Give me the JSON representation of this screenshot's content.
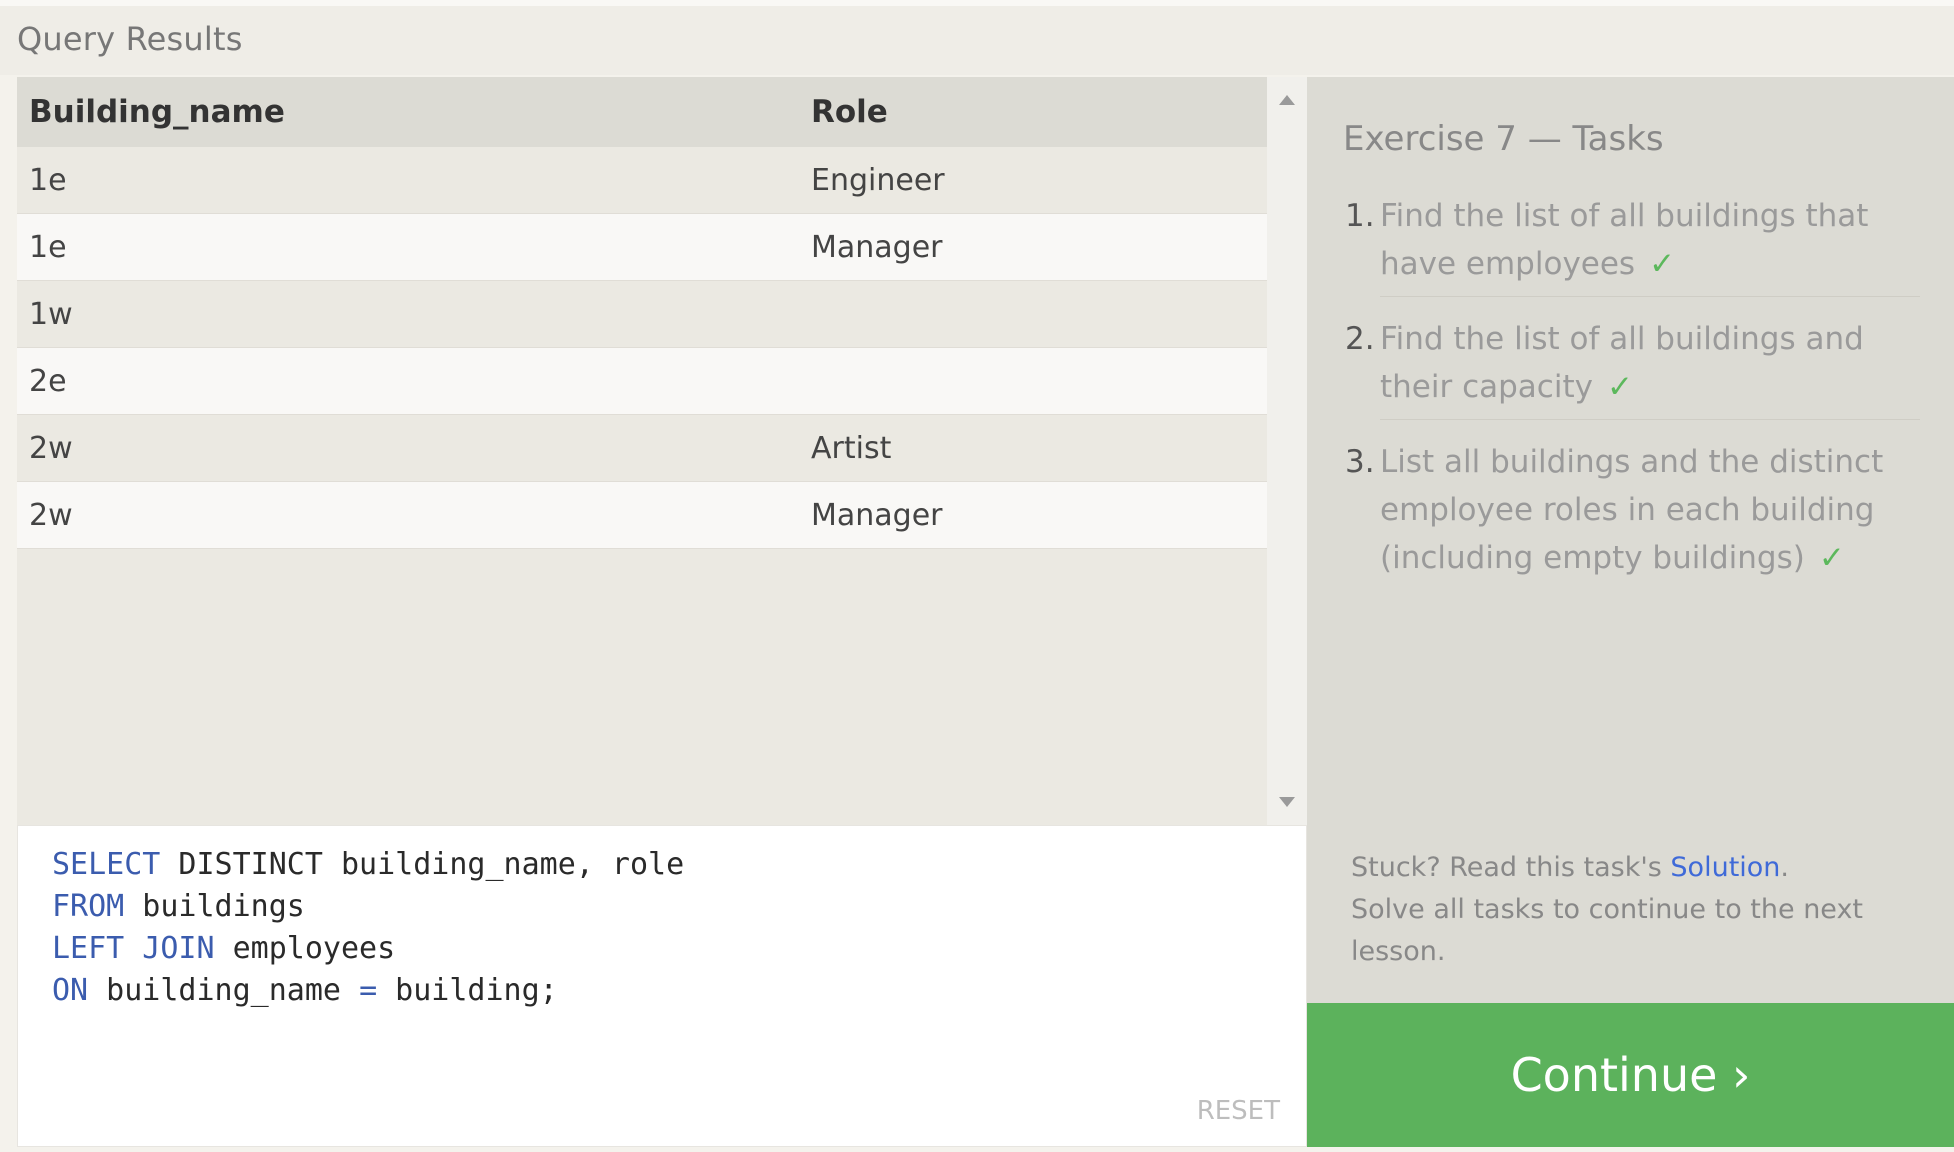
{
  "header": {
    "title": "Query Results"
  },
  "table": {
    "columns": [
      "Building_name",
      "Role"
    ],
    "rows": [
      [
        "1e",
        "Engineer"
      ],
      [
        "1e",
        "Manager"
      ],
      [
        "1w",
        ""
      ],
      [
        "2e",
        ""
      ],
      [
        "2w",
        "Artist"
      ],
      [
        "2w",
        "Manager"
      ]
    ]
  },
  "editor": {
    "lines": [
      [
        [
          "kw",
          "SELECT"
        ],
        [
          "id",
          " DISTINCT building_name, role"
        ]
      ],
      [
        [
          "kw",
          "FROM"
        ],
        [
          "id",
          " buildings"
        ]
      ],
      [
        [
          "kw",
          "LEFT JOIN"
        ],
        [
          "id",
          " employees"
        ]
      ],
      [
        [
          "kw",
          "ON"
        ],
        [
          "id",
          " building_name "
        ],
        [
          "kw",
          "="
        ],
        [
          "id",
          " building;"
        ]
      ]
    ],
    "reset_label": "RESET"
  },
  "tasks": {
    "title": "Exercise 7 — Tasks",
    "items": [
      {
        "num": "1.",
        "text": "Find the list of all buildings that have employees",
        "done": true
      },
      {
        "num": "2.",
        "text": "Find the list of all buildings and their capacity",
        "done": true
      },
      {
        "num": "3.",
        "text": "List all buildings and the distinct employee roles in each building (including empty buildings)",
        "done": true
      }
    ],
    "check_mark": "✓"
  },
  "help": {
    "stuck_prefix": "Stuck? Read this task's ",
    "solution_link": "Solution",
    "stuck_suffix": ".",
    "line2": "Solve all tasks to continue to the next lesson."
  },
  "continue_label": "Continue ›",
  "colors": {
    "accent_green": "#5cb25c",
    "check_green": "#5cb85c",
    "link_blue": "#3f6ad8",
    "keyword_blue": "#3b5cae"
  }
}
